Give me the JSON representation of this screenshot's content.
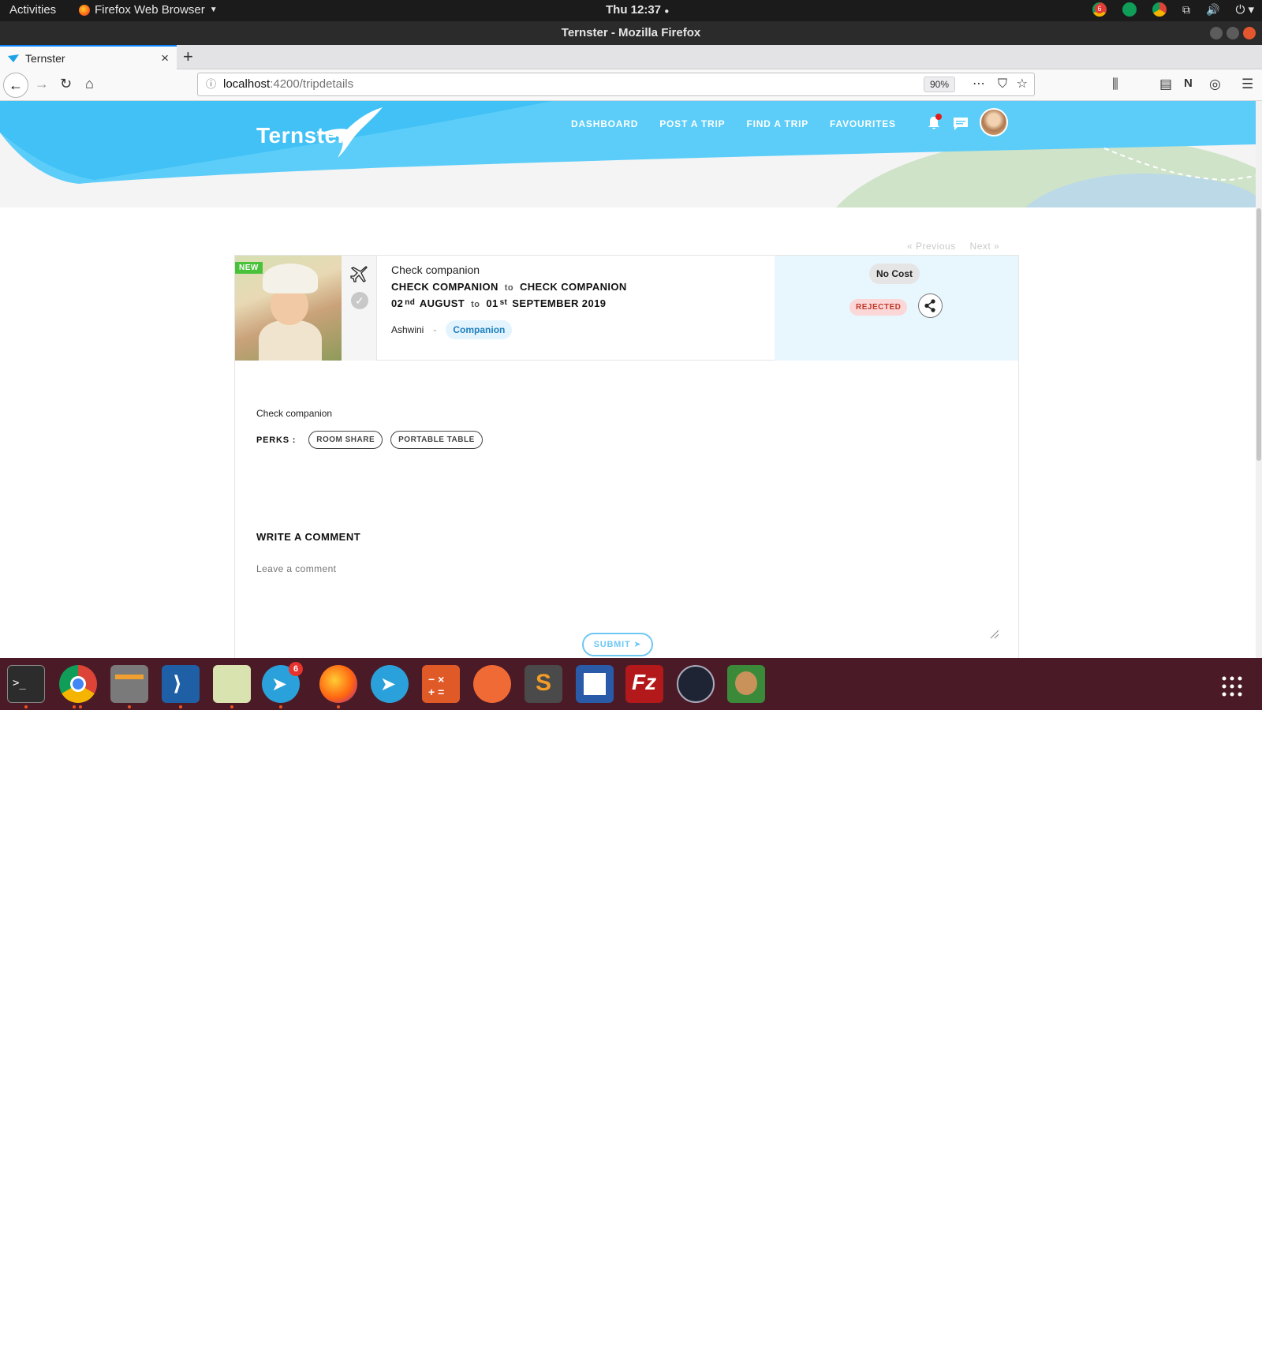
{
  "system": {
    "activities": "Activities",
    "app_name": "Firefox Web Browser",
    "clock": "Thu 12:37",
    "tray_badge": "6"
  },
  "window": {
    "title": "Ternster - Mozilla Firefox"
  },
  "browser": {
    "tab_title": "Ternster",
    "url_host": "localhost",
    "url_path": ":4200/tripdetails",
    "zoom": "90%"
  },
  "site": {
    "logo": "Ternster",
    "nav": [
      "DASHBOARD",
      "POST A TRIP",
      "FIND A TRIP",
      "FAVOURITES"
    ]
  },
  "pager": {
    "previous": "«  Previous",
    "next": "Next  »"
  },
  "trip": {
    "badge": "NEW",
    "title": "Check companion",
    "from": "CHECK COMPANION",
    "to_word": "to",
    "destination": "CHECK COMPANION",
    "start_day": "02",
    "start_suffix": "nd",
    "start_month": "AUGUST",
    "end_day": "01",
    "end_suffix": "st",
    "end_month_year": "SEPTEMBER 2019",
    "author": "Ashwini",
    "separator": "-",
    "type_tag": "Companion",
    "cost": "No Cost",
    "status": "REJECTED",
    "description": "Check companion",
    "perks_label": "PERKS :",
    "perks": [
      "ROOM SHARE",
      "PORTABLE TABLE"
    ]
  },
  "comment": {
    "title": "WRITE A COMMENT",
    "placeholder": "Leave a comment",
    "submit": "SUBMIT"
  },
  "dock": {
    "telegram_badge": "6"
  }
}
